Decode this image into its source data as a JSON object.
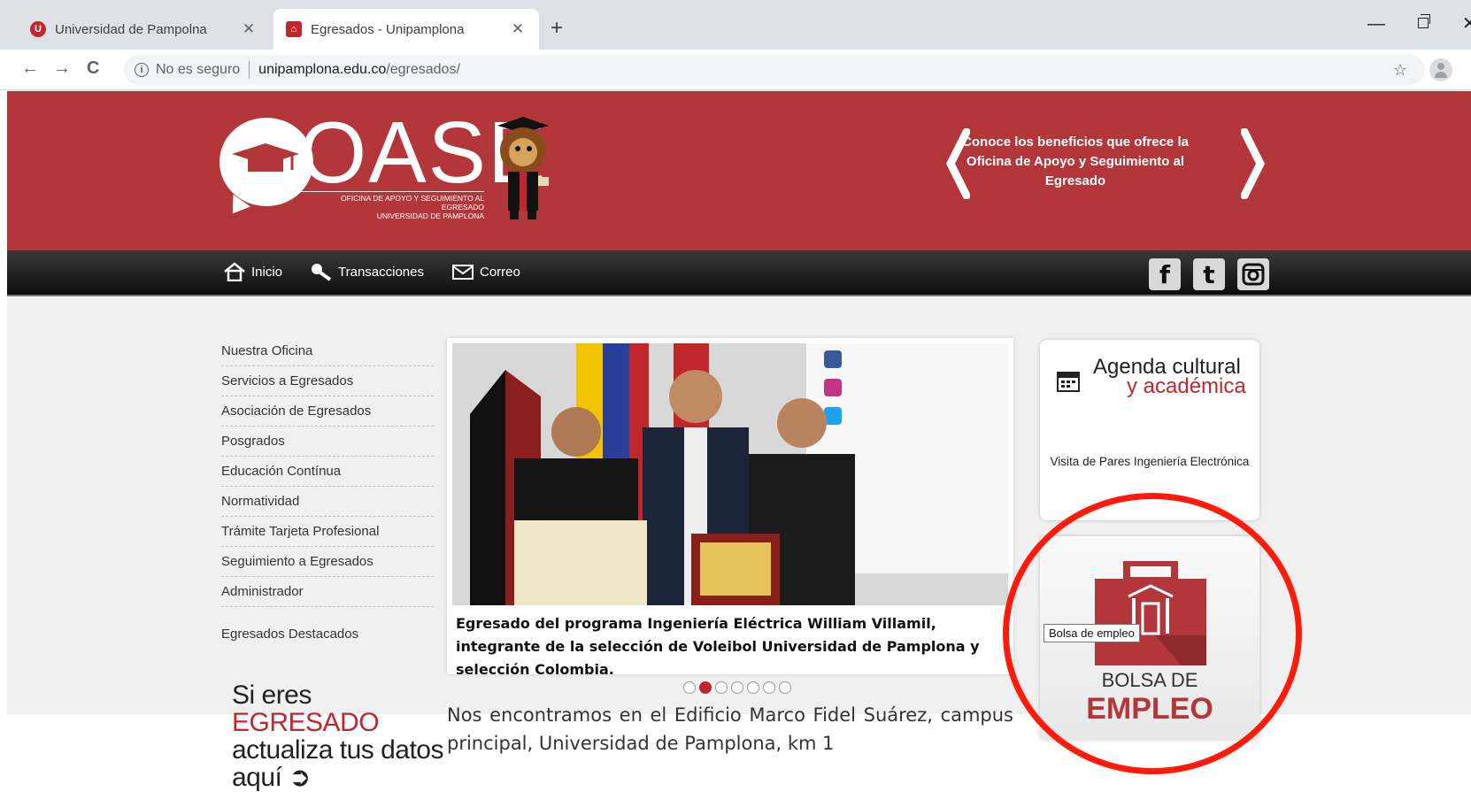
{
  "browser": {
    "tabs": [
      {
        "title": "Universidad de Pampolna",
        "favicon": "U",
        "active": false
      },
      {
        "title": "Egresados - Unipamplona",
        "favicon": "",
        "active": true
      }
    ],
    "address": {
      "security_label": "No es seguro",
      "host": "unipamplona.edu.co",
      "path": "/egresados/"
    }
  },
  "header": {
    "logo_word": "OASE",
    "logo_subtitle_1": "OFICINA DE APOYO Y SEGUIMIENTO AL EGRESADO",
    "logo_subtitle_2": "UNIVERSIDAD DE PAMPLONA",
    "promo_text": "Conoce los beneficios que ofrece la Oficina de Apoyo y Seguimiento al Egresado"
  },
  "nav": {
    "items": [
      "Inicio",
      "Transacciones",
      "Correo"
    ],
    "social": [
      "f",
      "t",
      "instagram"
    ]
  },
  "sidebar": {
    "items": [
      "Nuestra Oficina",
      "Servicios a Egresados",
      "Asociación de Egresados",
      "Posgrados",
      "Educación Contínua",
      "Normatividad",
      "Trámite Tarjeta Profesional",
      "Seguimiento a Egresados",
      "Administrador"
    ],
    "featured": "Egresados Destacados",
    "update_prompt": {
      "part1": "Si eres ",
      "highlight": "EGRESADO",
      "line2": "actualiza tus datos",
      "line3": "aquí ➲"
    }
  },
  "slider": {
    "caption": "Egresado del programa Ingeniería Eléctrica William Villamil, integrante de la selección de Voleibol Universidad de Pamplona y selección Colombia.",
    "dot_count": 7,
    "active_dot": 2
  },
  "address_text": "Nos encontramos en el Edificio Marco Fidel Suárez, campus principal, Universidad de Pamplona, km 1",
  "agenda": {
    "title_1": "Agenda cultural",
    "title_2": "y académica",
    "event": "Visita de Pares Ingeniería Electrónica"
  },
  "bolsa": {
    "tooltip": "Bolsa de empleo",
    "line1": "BOLSA DE",
    "line2": "EMPLEO"
  },
  "colors": {
    "brand_red": "#b3363a",
    "highlight_ring": "#ff1a0a"
  }
}
